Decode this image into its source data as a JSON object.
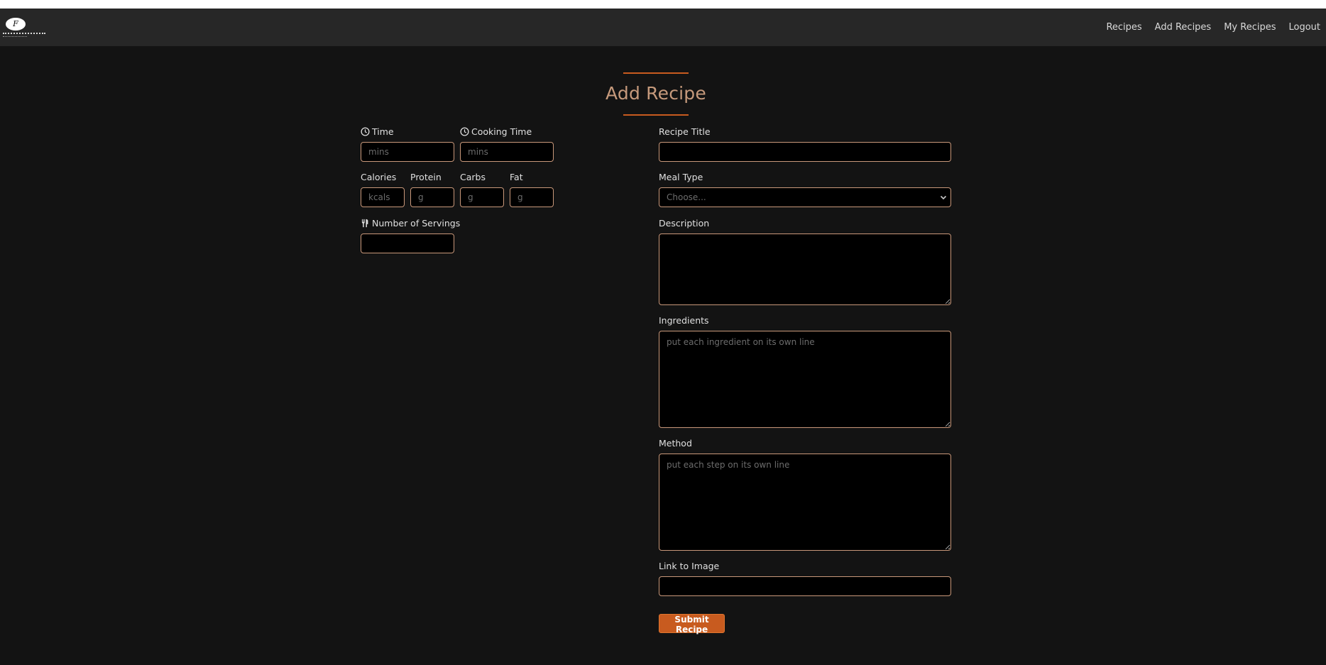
{
  "nav": {
    "logo_letter": "F",
    "links": [
      "Recipes",
      "Add Recipes",
      "My Recipes",
      "Logout"
    ]
  },
  "page": {
    "title": "Add Recipe"
  },
  "form_left": {
    "time": {
      "label": "Time",
      "placeholder": "mins",
      "icon": "clock-icon"
    },
    "cooking_time": {
      "label": "Cooking Time",
      "placeholder": "mins",
      "icon": "clock-icon"
    },
    "calories": {
      "label": "Calories",
      "placeholder": "kcals"
    },
    "protein": {
      "label": "Protein",
      "placeholder": "g"
    },
    "carbs": {
      "label": "Carbs",
      "placeholder": "g"
    },
    "fat": {
      "label": "Fat",
      "placeholder": "g"
    },
    "servings": {
      "label": "Number of Servings",
      "icon": "utensils-icon"
    }
  },
  "form_right": {
    "recipe_title": {
      "label": "Recipe Title"
    },
    "meal_type": {
      "label": "Meal Type",
      "selected": "Choose..."
    },
    "description": {
      "label": "Description"
    },
    "ingredients": {
      "label": "Ingredients",
      "placeholder": "put each ingredient on its own line"
    },
    "method": {
      "label": "Method",
      "placeholder": "put each step on its own line"
    },
    "image_link": {
      "label": "Link to Image"
    },
    "submit_label": "Submit Recipe"
  },
  "colors": {
    "background": "#131313",
    "navbar": "#272727",
    "accent": "#c85b1f",
    "title": "#c69a7c",
    "input_border": "#c9987a"
  }
}
